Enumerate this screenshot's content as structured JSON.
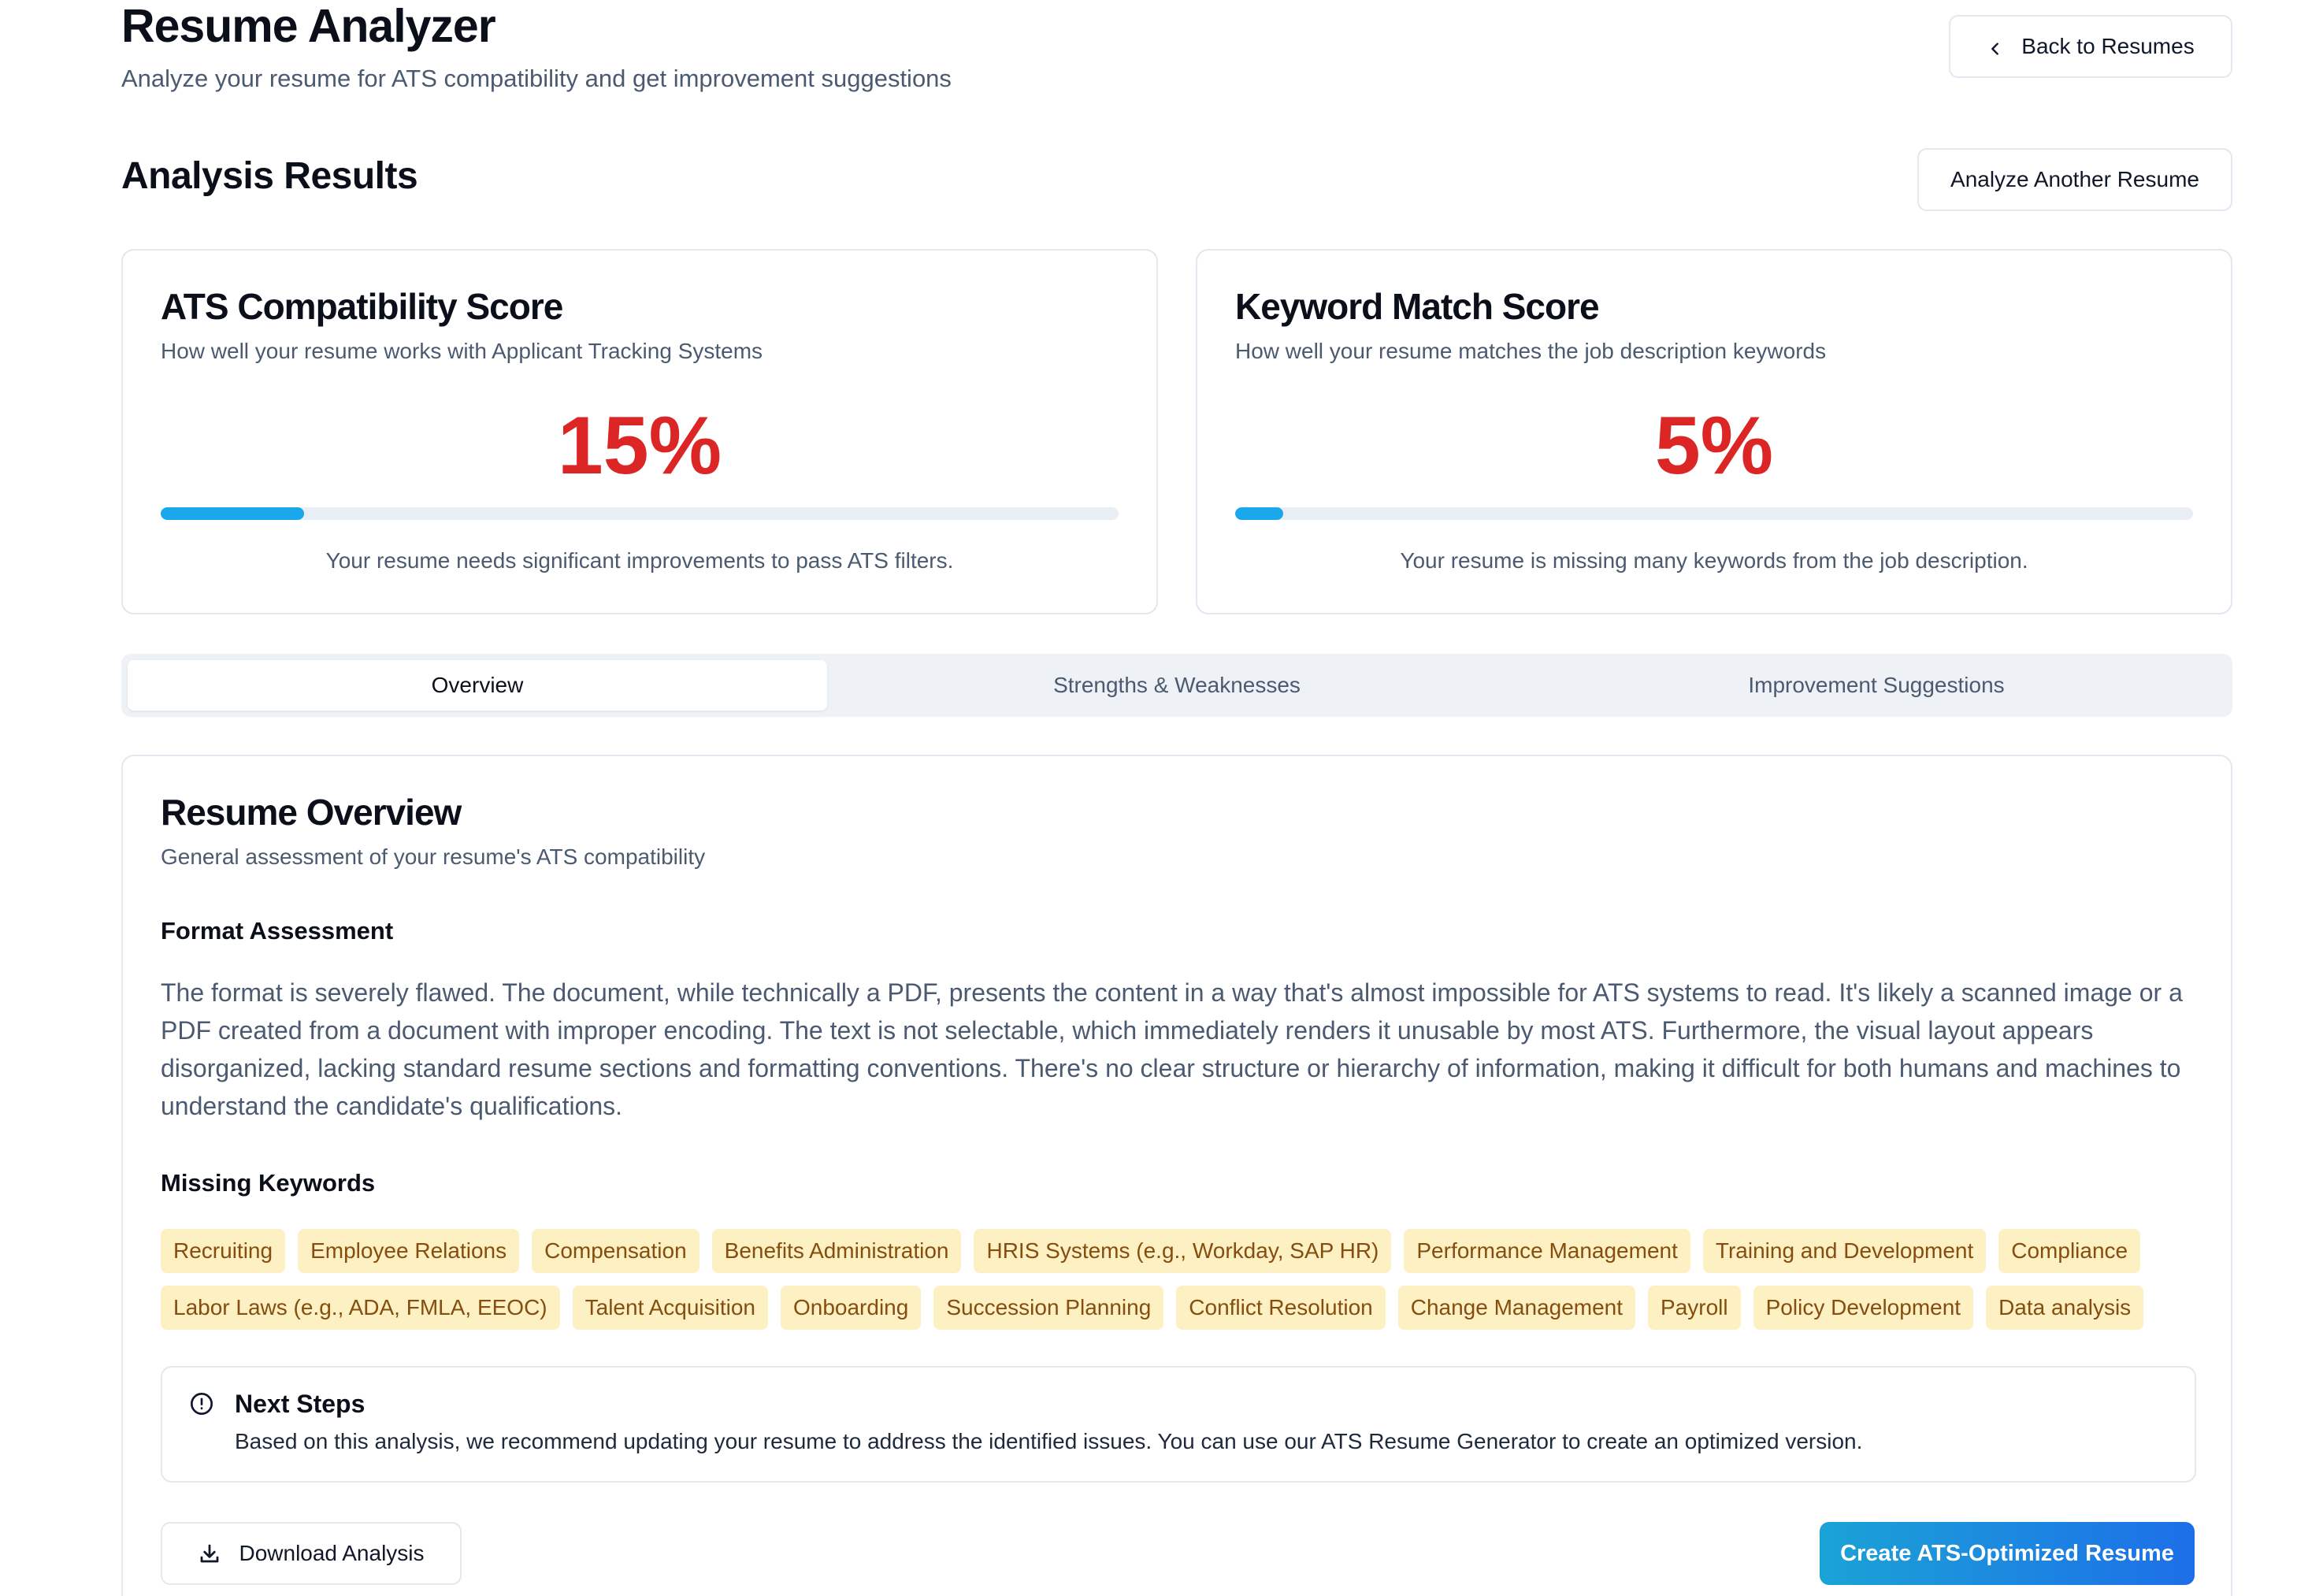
{
  "header": {
    "title": "Resume Analyzer",
    "subtitle": "Analyze your resume for ATS compatibility and get improvement suggestions",
    "back_button": "Back to Resumes",
    "back_icon": "chevron-left-icon"
  },
  "results": {
    "title": "Analysis Results",
    "analyze_another_button": "Analyze Another Resume"
  },
  "ats_score": {
    "title": "ATS Compatibility Score",
    "description": "How well your resume works with Applicant Tracking Systems",
    "value_text": "15%",
    "value": 0.15,
    "note": "Your resume needs significant improvements to pass ATS filters."
  },
  "keyword_score": {
    "title": "Keyword Match Score",
    "description": "How well your resume matches the job description keywords",
    "value_text": "5%",
    "value": 0.05,
    "note": "Your resume is missing many keywords from the job description."
  },
  "colors": {
    "score_red": "#dc2626",
    "progress_blue": "#1aa7ec",
    "keyword_bg": "#fdf0c3",
    "keyword_text": "#854d0e",
    "cta_gradient_start": "#1ba3d6",
    "cta_gradient_end": "#1d6fe8"
  },
  "tabs": [
    {
      "label": "Overview",
      "active": true
    },
    {
      "label": "Strengths & Weaknesses",
      "active": false
    },
    {
      "label": "Improvement Suggestions",
      "active": false
    }
  ],
  "overview": {
    "title": "Resume Overview",
    "description": "General assessment of your resume's ATS compatibility",
    "format_heading": "Format Assessment",
    "format_text": "The format is severely flawed. The document, while technically a PDF, presents the content in a way that's almost impossible for ATS systems to read. It's likely a scanned image or a PDF created from a document with improper encoding. The text is not selectable, which immediately renders it unusable by most ATS. Furthermore, the visual layout appears disorganized, lacking standard resume sections and formatting conventions. There's no clear structure or hierarchy of information, making it difficult for both humans and machines to understand the candidate's qualifications.",
    "missing_keywords_heading": "Missing Keywords",
    "keywords_row1": [
      "Recruiting",
      "Employee Relations",
      "Compensation",
      "Benefits Administration",
      "HRIS Systems (e.g., Workday, SAP HR)",
      "Performance Management",
      "Training and Development",
      "Compliance"
    ],
    "keywords_row2": [
      "Labor Laws (e.g., ADA, FMLA, EEOC)",
      "Talent Acquisition",
      "Onboarding",
      "Succession Planning",
      "Conflict Resolution",
      "Change Management",
      "Payroll",
      "Policy Development",
      "Data analysis"
    ]
  },
  "next_steps": {
    "icon": "alert-circle-icon",
    "title": "Next Steps",
    "text": "Based on this analysis, we recommend updating your resume to address the identified issues. You can use our ATS Resume Generator to create an optimized version."
  },
  "actions": {
    "download_label": "Download Analysis",
    "download_icon": "download-icon",
    "create_label": "Create ATS-Optimized Resume"
  }
}
